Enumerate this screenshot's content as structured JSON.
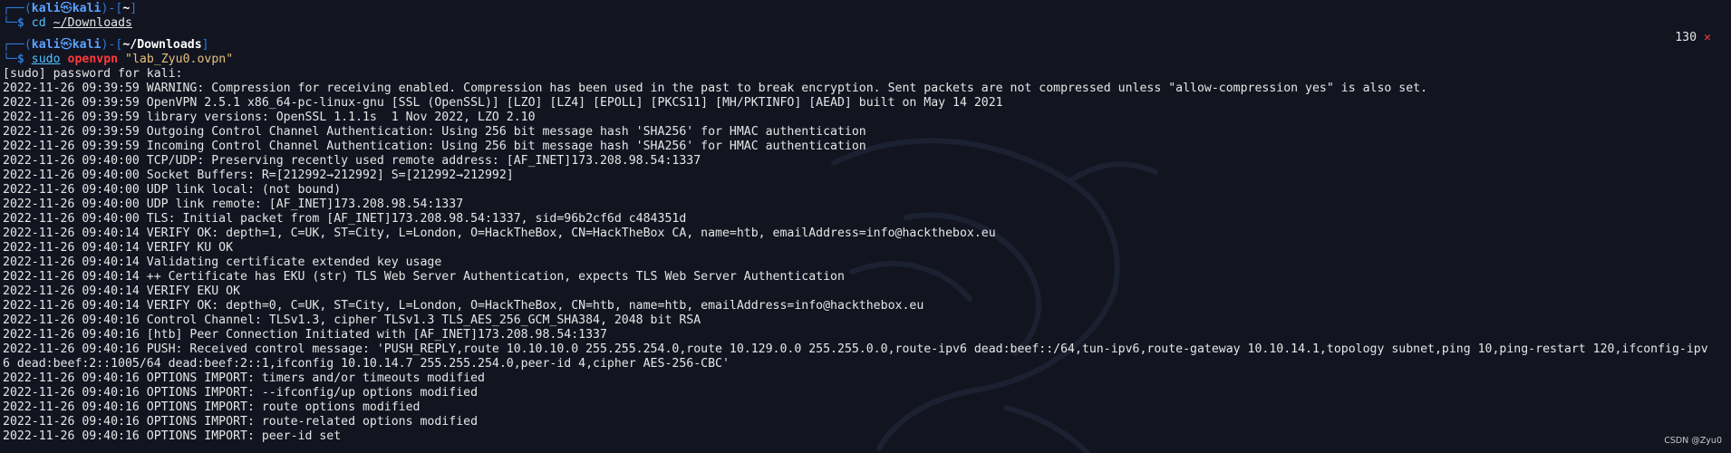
{
  "prompt1": {
    "frame_top": "┌──(",
    "user": "kali",
    "skull": "㉿",
    "host": "kali",
    "frame_mid": ")-[",
    "path": "~",
    "frame_end": "]",
    "frame_bottom": "└─",
    "dollar": "$",
    "cmd": "cd",
    "arg": "~/Downloads",
    "exit_code": "130",
    "exit_mark": "✕"
  },
  "prompt2": {
    "frame_top": "┌──(",
    "user": "kali",
    "skull": "㉿",
    "host": "kali",
    "frame_mid": ")-[",
    "path": "~/Downloads",
    "frame_end": "]",
    "frame_bottom": "└─",
    "dollar": "$",
    "sudo": "sudo",
    "cmd": "openvpn",
    "arg": "\"lab_Zyu0.ovpn\""
  },
  "output": [
    "[sudo] password for kali:",
    "2022-11-26 09:39:59 WARNING: Compression for receiving enabled. Compression has been used in the past to break encryption. Sent packets are not compressed unless \"allow-compression yes\" is also set.",
    "2022-11-26 09:39:59 OpenVPN 2.5.1 x86_64-pc-linux-gnu [SSL (OpenSSL)] [LZO] [LZ4] [EPOLL] [PKCS11] [MH/PKTINFO] [AEAD] built on May 14 2021",
    "2022-11-26 09:39:59 library versions: OpenSSL 1.1.1s  1 Nov 2022, LZO 2.10",
    "2022-11-26 09:39:59 Outgoing Control Channel Authentication: Using 256 bit message hash 'SHA256' for HMAC authentication",
    "2022-11-26 09:39:59 Incoming Control Channel Authentication: Using 256 bit message hash 'SHA256' for HMAC authentication",
    "2022-11-26 09:40:00 TCP/UDP: Preserving recently used remote address: [AF_INET]173.208.98.54:1337",
    "2022-11-26 09:40:00 Socket Buffers: R=[212992→212992] S=[212992→212992]",
    "2022-11-26 09:40:00 UDP link local: (not bound)",
    "2022-11-26 09:40:00 UDP link remote: [AF_INET]173.208.98.54:1337",
    "2022-11-26 09:40:00 TLS: Initial packet from [AF_INET]173.208.98.54:1337, sid=96b2cf6d c484351d",
    "2022-11-26 09:40:14 VERIFY OK: depth=1, C=UK, ST=City, L=London, O=HackTheBox, CN=HackTheBox CA, name=htb, emailAddress=info@hackthebox.eu",
    "2022-11-26 09:40:14 VERIFY KU OK",
    "2022-11-26 09:40:14 Validating certificate extended key usage",
    "2022-11-26 09:40:14 ++ Certificate has EKU (str) TLS Web Server Authentication, expects TLS Web Server Authentication",
    "2022-11-26 09:40:14 VERIFY EKU OK",
    "2022-11-26 09:40:14 VERIFY OK: depth=0, C=UK, ST=City, L=London, O=HackTheBox, CN=htb, name=htb, emailAddress=info@hackthebox.eu",
    "2022-11-26 09:40:16 Control Channel: TLSv1.3, cipher TLSv1.3 TLS_AES_256_GCM_SHA384, 2048 bit RSA",
    "2022-11-26 09:40:16 [htb] Peer Connection Initiated with [AF_INET]173.208.98.54:1337",
    "2022-11-26 09:40:16 PUSH: Received control message: 'PUSH_REPLY,route 10.10.10.0 255.255.254.0,route 10.129.0.0 255.255.0.0,route-ipv6 dead:beef::/64,tun-ipv6,route-gateway 10.10.14.1,topology subnet,ping 10,ping-restart 120,ifconfig-ipv",
    "6 dead:beef:2::1005/64 dead:beef:2::1,ifconfig 10.10.14.7 255.255.254.0,peer-id 4,cipher AES-256-CBC'",
    "2022-11-26 09:40:16 OPTIONS IMPORT: timers and/or timeouts modified",
    "2022-11-26 09:40:16 OPTIONS IMPORT: --ifconfig/up options modified",
    "2022-11-26 09:40:16 OPTIONS IMPORT: route options modified",
    "2022-11-26 09:40:16 OPTIONS IMPORT: route-related options modified",
    "2022-11-26 09:40:16 OPTIONS IMPORT: peer-id set"
  ],
  "watermark": "CSDN @Zyu0",
  "colors": {
    "background": "#121420",
    "prompt_frame": "#2b7bd9",
    "prompt_user": "#5aa2ff",
    "command": "#4fc3ff",
    "openvpn": "#ff3b3b",
    "string": "#e5c07b",
    "text": "#e6e6e6"
  },
  "icons": {
    "background_logo": "kali-dragon-icon",
    "exit_mark": "x-icon"
  }
}
